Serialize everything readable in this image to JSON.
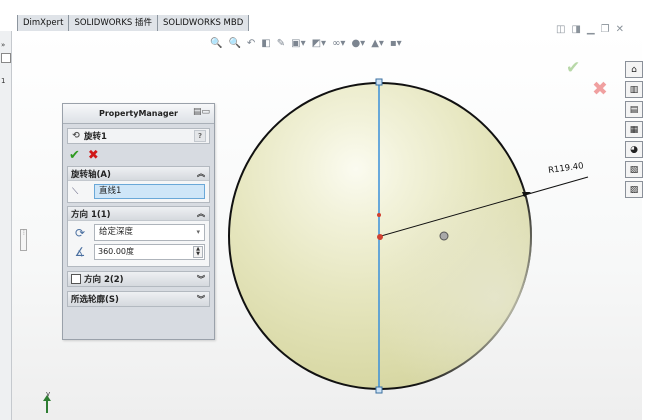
{
  "tabs": [
    "DimXpert",
    "SOLIDWORKS 插件",
    "SOLIDWORKS MBD"
  ],
  "left_marks": [
    "»",
    "1"
  ],
  "view_toolbar_icons": [
    "zoom-to-fit-icon",
    "zoom-area-icon",
    "previous-view-icon",
    "section-view-icon",
    "dynamic-annotation-icon",
    "view-orientation-icon",
    "display-style-icon",
    "hide-show-icon",
    "edit-appearance-icon",
    "apply-scene-icon",
    "view-settings-icon"
  ],
  "window_controls": [
    "restore-pane-icon",
    "tile-icon",
    "minimize-icon",
    "maximize-icon",
    "close-icon"
  ],
  "property_manager": {
    "title": "PropertyManager",
    "feature_name": "旋转1",
    "help": "?",
    "axis_group": {
      "label": "旋转轴(A)",
      "value": "直线1"
    },
    "direction1_group": {
      "label": "方向 1(1)",
      "end_condition": "给定深度",
      "angle": "360.00度"
    },
    "direction2_group": {
      "label": "方向 2(2)"
    },
    "contours_group": {
      "label": "所选轮廓(S)"
    }
  },
  "dimension": {
    "label": "R119.40"
  },
  "triad": {
    "axis": "y"
  },
  "colors": {
    "axis_line": "#3a8fd9",
    "ok": "#2e9a20",
    "cancel": "#d01818",
    "sphere": "#e6e6bf"
  }
}
